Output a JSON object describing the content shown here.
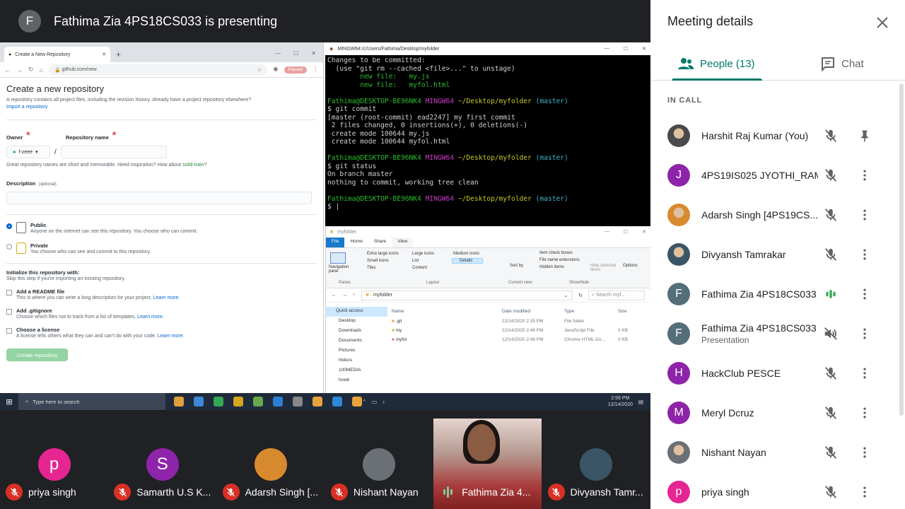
{
  "presenter_bar": {
    "avatar_letter": "F",
    "title": "Fathima Zia 4PS18CS033 is presenting"
  },
  "shared_screen": {
    "browser": {
      "tab_title": "Create a New Repository",
      "url": "github.com/new",
      "paused_label": "Paused",
      "heading": "Create a new repository",
      "intro": "A repository contains all project files, including the revision history. Already have a project repository elsewhere?",
      "import_link": "Import a repository",
      "owner_label": "Owner",
      "repo_name_label": "Repository name",
      "owner_value": "f-zeee",
      "slash": "/",
      "hint": "Great repository names are short and memorable. Need inspiration? How about",
      "hint_suggestion": "solid-train",
      "hint_end": "?",
      "description_label": "Description",
      "optional": "(optional)",
      "public_title": "Public",
      "public_desc": "Anyone on the internet can see this repository. You choose who can commit.",
      "private_title": "Private",
      "private_desc": "You choose who can see and commit to this repository.",
      "init_title": "Initialize this repository with:",
      "init_desc": "Skip this step if you're importing an existing repository.",
      "readme_title": "Add a README file",
      "readme_desc": "This is where you can write a long description for your project.",
      "gitignore_title": "Add .gitignore",
      "gitignore_desc": "Choose which files not to track from a list of templates.",
      "license_title": "Choose a license",
      "license_desc": "A license tells others what they can and can't do with your code.",
      "learn_more": "Learn more.",
      "create_button": "Create repository"
    },
    "terminal": {
      "title": "MINGW64:/c/Users/Fathima/Desktop/myfolder",
      "lines": {
        "l1": "Changes to be committed:",
        "l2": "  (use \"git rm --cached <file>...\" to unstage)",
        "l3": "        new file:   my.js",
        "l4": "        new file:   myfol.html",
        "p_user": "Fathima@DESKTOP-BE96NK4",
        "p_env": "MINGW64",
        "p_path": "~/Desktop/myfolder",
        "p_branch": "(master)",
        "l6": "$ git commit",
        "l7": "[master (root-commit) ead2247] my first commit",
        "l8": " 2 files changed, 0 insertions(+), 0 deletions(-)",
        "l9": " create mode 100644 my.js",
        "l10": " create mode 100644 myfol.html",
        "l12": "$ git status",
        "l13": "On branch master",
        "l14": "nothing to commit, working tree clean",
        "l16": "$ |"
      }
    },
    "explorer": {
      "title": "myfolder",
      "ribbon_tabs": [
        "File",
        "Home",
        "Share",
        "View"
      ],
      "ribbon_labels": {
        "nav_pane": "Navigation pane",
        "extra_large": "Extra large icons",
        "large": "Large icons",
        "medium": "Medium icons",
        "small": "Small icons",
        "list": "List",
        "details": "Details",
        "tiles": "Tiles",
        "content": "Content",
        "sort_by": "Sort by",
        "item_checkboxes": "Item check boxes",
        "file_name_ext": "File name extensions",
        "hidden_items": "Hidden items",
        "hide_selected": "Hide selected items",
        "options": "Options",
        "panes": "Panes",
        "layout": "Layout",
        "current_view": "Current view",
        "show_hide": "Show/hide"
      },
      "path": "myfolder",
      "search_placeholder": "Search myf...",
      "nav_items": [
        "Quick access",
        "Desktop",
        "Downloads",
        "Documents",
        "Pictures",
        "htdocs",
        "100MEDIA",
        "hcwb"
      ],
      "columns": [
        "Name",
        "Date modified",
        "Type",
        "Size"
      ],
      "rows": [
        {
          "name": ".git",
          "date": "12/14/2020 2:35 PM",
          "type": "File folder",
          "size": ""
        },
        {
          "name": "my",
          "date": "12/14/2020 2:48 PM",
          "type": "JavaScript File",
          "size": "0 KB"
        },
        {
          "name": "myfol",
          "date": "12/14/2020 2:48 PM",
          "type": "Chrome HTML Do...",
          "size": "0 KB"
        }
      ]
    },
    "taskbar": {
      "search_placeholder": "Type here to search",
      "time": "2:56 PM",
      "date": "12/14/2020",
      "icon_colors": [
        "#e0a040",
        "#3d88d8",
        "#34a853",
        "#d4a520",
        "#6aa84f",
        "#2d7fd3",
        "#888888",
        "#e8a33d",
        "#2b89d8",
        "#e8a33d"
      ]
    }
  },
  "strip": [
    {
      "name": "priya singh",
      "letter": "p",
      "color": "#e52592",
      "state": "muted"
    },
    {
      "name": "Samarth U.S K...",
      "letter": "S",
      "color": "#8e24aa",
      "state": "muted"
    },
    {
      "name": "Adarsh Singh [...",
      "letter": "",
      "color": "#d88a2e",
      "state": "muted"
    },
    {
      "name": "Nishant Nayan",
      "letter": "",
      "color": "#6b7076",
      "state": "muted"
    },
    {
      "name": "Fathima Zia 4...",
      "letter": "",
      "color": "",
      "state": "speaking"
    },
    {
      "name": "Divyansh Tamr...",
      "letter": "",
      "color": "#3a5565",
      "state": "muted"
    }
  ],
  "panel": {
    "title": "Meeting details",
    "people_tab": "People (13)",
    "chat_tab": "Chat",
    "section": "IN CALL",
    "people": [
      {
        "name": "Harshit Raj Kumar (You)",
        "sub": "",
        "letter": "",
        "color": "#4a4a4a",
        "mic": "muted",
        "action": "pin"
      },
      {
        "name": "4PS19IS025 JYOTHI_RAM",
        "sub": "",
        "letter": "J",
        "color": "#8e24aa",
        "mic": "muted",
        "action": "more"
      },
      {
        "name": "Adarsh Singh [4PS19CS...",
        "sub": "",
        "letter": "",
        "color": "#d88a2e",
        "mic": "muted",
        "action": "more"
      },
      {
        "name": "Divyansh Tamrakar",
        "sub": "",
        "letter": "",
        "color": "#3a5565",
        "mic": "muted",
        "action": "more"
      },
      {
        "name": "Fathima Zia 4PS18CS033",
        "sub": "",
        "letter": "F",
        "color": "#546e7a",
        "mic": "speaking",
        "action": "more"
      },
      {
        "name": "Fathima Zia 4PS18CS033",
        "sub": "Presentation",
        "letter": "F",
        "color": "#546e7a",
        "mic": "volume-off",
        "action": "more"
      },
      {
        "name": "HackClub PESCE",
        "sub": "",
        "letter": "H",
        "color": "#8e24aa",
        "mic": "muted",
        "action": "more"
      },
      {
        "name": "Meryl Dcruz",
        "sub": "",
        "letter": "M",
        "color": "#8e24aa",
        "mic": "muted",
        "action": "more"
      },
      {
        "name": "Nishant Nayan",
        "sub": "",
        "letter": "",
        "color": "#6b7076",
        "mic": "muted",
        "action": "more"
      },
      {
        "name": "priya singh",
        "sub": "",
        "letter": "p",
        "color": "#e52592",
        "mic": "muted",
        "action": "more"
      }
    ]
  }
}
